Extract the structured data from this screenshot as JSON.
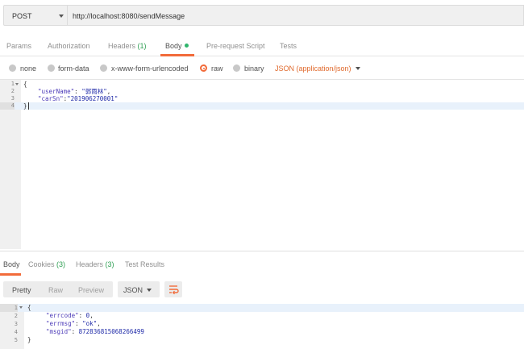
{
  "request": {
    "method": "POST",
    "url": "http://localhost:8080/sendMessage"
  },
  "request_tabs": [
    {
      "label": "Params"
    },
    {
      "label": "Authorization"
    },
    {
      "label": "Headers",
      "count": "(1)"
    },
    {
      "label": "Body"
    },
    {
      "label": "Pre-request Script"
    },
    {
      "label": "Tests"
    }
  ],
  "body_types": {
    "none": "none",
    "form_data": "form-data",
    "urlencoded": "x-www-form-urlencoded",
    "raw": "raw",
    "binary": "binary",
    "format": "JSON (application/json)",
    "selected": "raw"
  },
  "request_body": {
    "line_numbers": [
      "1",
      "2",
      "3",
      "4"
    ],
    "open": "{",
    "key1": "\"userName\"",
    "sep1": ": ",
    "val1": "\"郭雨林\"",
    "end1": ",",
    "key2": "\"carSn\"",
    "sep2": ":",
    "val2": "\"201906270001\"",
    "close": "}"
  },
  "response_tabs": [
    {
      "label": "Body"
    },
    {
      "label": "Cookies",
      "count": "(3)"
    },
    {
      "label": "Headers",
      "count": "(3)"
    },
    {
      "label": "Test Results"
    }
  ],
  "response_toolbar": {
    "pretty": "Pretty",
    "raw": "Raw",
    "preview": "Preview",
    "format": "JSON"
  },
  "response_body": {
    "line_numbers": [
      "1",
      "2",
      "3",
      "4",
      "5"
    ],
    "open": "{",
    "key1": "\"errcode\"",
    "val1": "0",
    "key2": "\"errmsg\"",
    "val2": "\"ok\"",
    "key3": "\"msgid\"",
    "val3": "872836815068266499",
    "close": "}"
  },
  "colors": {
    "accent": "#f26b3a",
    "count_green": "#2f9f53",
    "json_format": "#e0692c"
  }
}
